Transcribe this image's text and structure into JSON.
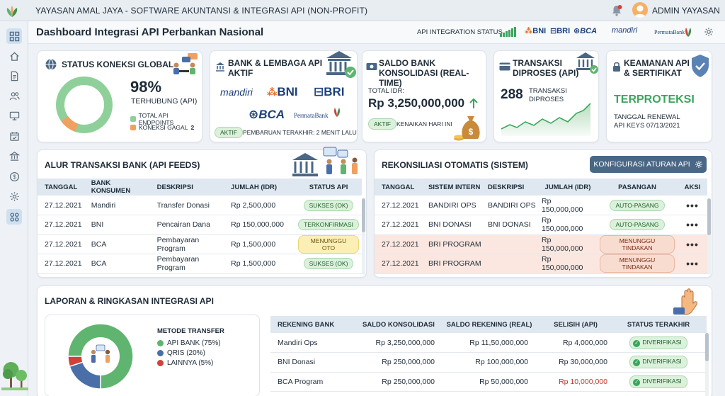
{
  "app": {
    "title": "YAYASAN AMAL JAYA - SOFTWARE AKUNTANSI & INTEGRASI API (NON-PROFIT)",
    "user": "ADMIN YAYASAN"
  },
  "header": {
    "title": "Dashboard Integrasi API Perbankan Nasional",
    "api_status_label": "API INTEGRATION STATUS",
    "banks": [
      "BNI",
      "BRI",
      "BCA",
      "mandiri",
      "PermataBank"
    ]
  },
  "sidebar": {
    "items": [
      "grid",
      "home",
      "document",
      "users",
      "monitor",
      "calendar-check",
      "bank",
      "dollar",
      "settings",
      "integration"
    ]
  },
  "cards": {
    "global": {
      "title": "STATUS KONEKSI GLOBAL",
      "percent": "98%",
      "percent_label": "TERHUBUNG (API)",
      "legend_total": "TOTAL API ENDPOINTS",
      "legend_failed": "KONEKSI GAGAL",
      "failed_count": "2",
      "connected_fraction": 0.98
    },
    "banks": {
      "title_l1": "BANK & LEMBAGA API",
      "title_l2": "AKTIF",
      "logos": [
        "mandiri",
        "BNI",
        "BRI",
        "BCA",
        "PermataBank"
      ],
      "badge": "AKTIF",
      "update": "PEMBARUAN TERAKHIR: 2 MENIT LALU"
    },
    "saldo": {
      "title_l1": "SALDO BANK",
      "title_l2": "KONSOLIDASI (REAL-TIME)",
      "label": "TOTAL IDR:",
      "amount": "Rp 3,250,000,000",
      "badge": "AKTIF",
      "note": "KENAIKAN HARI INI"
    },
    "transaksi": {
      "title_l1": "TRANSAKSI",
      "title_l2": "DIPROSES (API)",
      "count": "288",
      "label_l1": "TRANSAKSI",
      "label_l2": "DIPROSES"
    },
    "keamanan": {
      "title_l1": "KEAMANAN API",
      "title_l2": "& SERTIFIKAT",
      "status": "TERPROTEKSI",
      "renew_l1": "TANGGAL RENEWAL",
      "renew_l2": "API KEYS 07/13/2021"
    }
  },
  "alur": {
    "title": "ALUR TRANSAKSI BANK (API FEEDS)",
    "columns": [
      "TANGGAL",
      "BANK KONSUMEN",
      "DESKRIPSI",
      "JUMLAH (IDR)",
      "STATUS API"
    ],
    "rows": [
      {
        "tanggal": "27.12.2021",
        "bank": "Mandiri",
        "deskripsi": "Transfer Donasi",
        "jumlah": "Rp 2,500,000",
        "status": "SUKSES (OK)"
      },
      {
        "tanggal": "27.12.2021",
        "bank": "BNI",
        "deskripsi": "Pencairan Dana",
        "jumlah": "Rp 150,000,000",
        "status": "TERKONFIRMASI"
      },
      {
        "tanggal": "27.12.2021",
        "bank": "BCA",
        "deskripsi": "Pembayaran Program",
        "jumlah": "Rp 1,500,000",
        "status": "MENUNGGU OTO"
      },
      {
        "tanggal": "27.12.2021",
        "bank": "BCA",
        "deskripsi": "Pembayaran Program",
        "jumlah": "Rp 1,500,000",
        "status": "SUKSES (OK)"
      }
    ]
  },
  "rekon": {
    "title": "REKONSILIASI OTOMATIS (SISTEM)",
    "button": "KONFIGURASI ATURAN API",
    "columns": [
      "TANGGAL",
      "SISTEM INTERN",
      "DESKRIPSI",
      "JUMLAH (IDR)",
      "PASANGAN",
      "AKSI"
    ],
    "rows": [
      {
        "tanggal": "27.12.2021",
        "sistem": "BANDIRI OPS",
        "deskripsi": "BANDIRI OPS",
        "jumlah": "Rp 150,000,000",
        "pasangan": "AUTO-PASANG",
        "aksi": "•••"
      },
      {
        "tanggal": "27.12.2021",
        "sistem": "BNI DONASI",
        "deskripsi": "BNI DONASI",
        "jumlah": "Rp 150,000,000",
        "pasangan": "AUTO-PASANG",
        "aksi": "•••"
      },
      {
        "tanggal": "27.12.2021",
        "sistem": "BRI PROGRAM",
        "deskripsi": "",
        "jumlah": "Rp 150,000,000",
        "pasangan": "MENUNGGU TINDAKAN",
        "aksi": "•••"
      },
      {
        "tanggal": "27.12.2021",
        "sistem": "BRI PROGRAM",
        "deskripsi": "",
        "jumlah": "Rp 150,000,000",
        "pasangan": "MENUNGGU TINDAKAN",
        "aksi": "•••"
      }
    ]
  },
  "laporan": {
    "title": "LAPORAN & RINGKASAN INTEGRASI API",
    "legend_title": "METODE TRANSFER",
    "legend": [
      {
        "label": "API BANK (75%)",
        "color": "#5fb56f"
      },
      {
        "label": "QRIS (20%)",
        "color": "#4a6fa8"
      },
      {
        "label": "LAINNYA (5%)",
        "color": "#d0413a"
      }
    ],
    "columns": [
      "REKENING BANK",
      "SALDO KONSOLIDASI",
      "SALDO REKENING (REAL)",
      "SELISIH (API)",
      "STATUS TERAKHIR"
    ],
    "rows": [
      {
        "rekening": "Mandiri Ops",
        "saldo": "Rp 3,250,000,000",
        "real": "Rp 11,50,000,000",
        "selisih": "Rp 4,000,000",
        "status": "DIVERIFIKASI"
      },
      {
        "rekening": "BNI Donasi",
        "saldo": "Rp 250,000,000",
        "real": "Rp 100,000,000",
        "selisih": "Rp 30,000,000",
        "status": "DIVERIFIKASI"
      },
      {
        "rekening": "BCA Program",
        "saldo": "Rp 250,000,000",
        "real": "Rp 50,000,000",
        "selisih": "Rp 10,000,000",
        "status": "DIVERIFIKASI"
      }
    ]
  },
  "chart_data": {
    "type": "pie",
    "categories": [
      "API BANK",
      "QRIS",
      "LAINNYA"
    ],
    "values": [
      75,
      20,
      5
    ],
    "title": "METODE TRANSFER"
  },
  "colors": {
    "accent": "#4a6785",
    "green": "#5fb56f",
    "blue": "#4a6fa8",
    "red": "#d0413a",
    "orange": "#f0a060"
  }
}
